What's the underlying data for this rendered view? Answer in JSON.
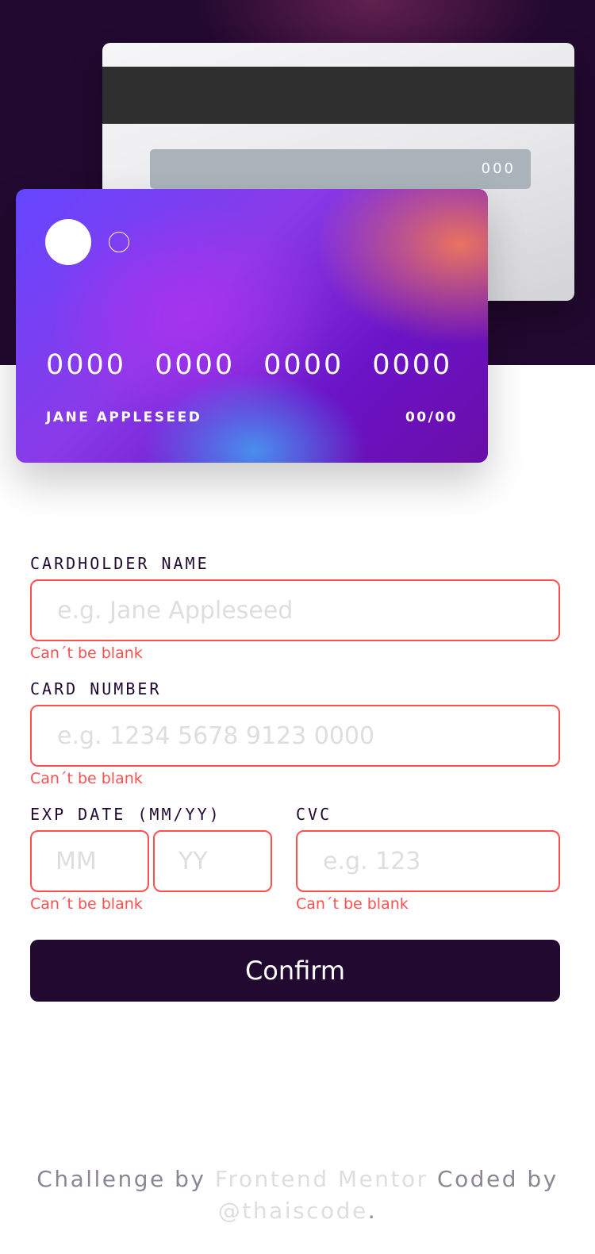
{
  "card_back": {
    "cvc": "000"
  },
  "card_front": {
    "number_groups": [
      "0000",
      "0000",
      "0000",
      "0000"
    ],
    "name": "JANE APPLESEED",
    "expiry": "00/00"
  },
  "form": {
    "name_label": "CARDHOLDER NAME",
    "name_placeholder": "e.g. Jane Appleseed",
    "name_value": "",
    "name_error": "Can´t be blank",
    "number_label": "CARD NUMBER",
    "number_placeholder": "e.g. 1234 5678 9123 0000",
    "number_value": "",
    "number_error": "Can´t be blank",
    "exp_label": "EXP DATE (MM/YY)",
    "mm_placeholder": "MM",
    "yy_placeholder": "YY",
    "exp_error": "Can´t be blank",
    "cvc_label": "CVC",
    "cvc_placeholder": "e.g. 123",
    "cvc_error": "Can´t be blank",
    "confirm_label": "Confirm"
  },
  "footer": {
    "prefix": "Challenge by ",
    "link1": "Frontend Mentor",
    "middle": " Coded by ",
    "link2": "@thaiscode",
    "suffix": "."
  },
  "colors": {
    "dark": "#21092f",
    "error": "#ff5050",
    "placeholder": "#dedddf"
  }
}
